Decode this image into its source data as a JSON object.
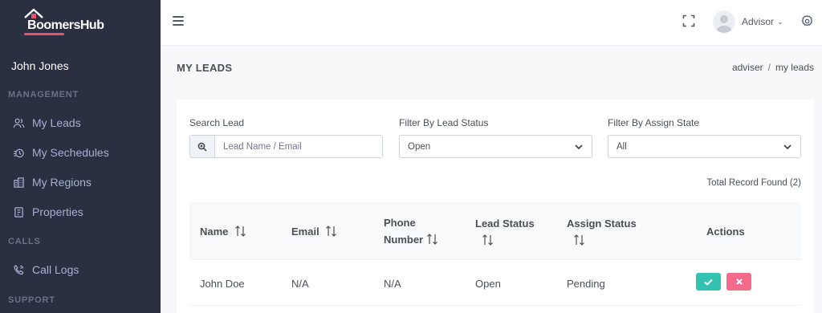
{
  "brand": {
    "logo_text_b": "B",
    "logo_text_rest": "oomers",
    "logo_text_h": "Hub"
  },
  "sidebar": {
    "user_name": "John Jones",
    "sections": [
      {
        "title": "MANAGEMENT"
      },
      {
        "title": "CALLS"
      },
      {
        "title": "SUPPORT"
      }
    ],
    "items": [
      {
        "label": "My Leads",
        "icon": "users-icon"
      },
      {
        "label": "My Sechedules",
        "icon": "schedule-icon"
      },
      {
        "label": "My Regions",
        "icon": "buildings-icon"
      },
      {
        "label": "Properties",
        "icon": "property-icon"
      },
      {
        "label": "Call Logs",
        "icon": "phone-icon"
      }
    ]
  },
  "topbar": {
    "user_label": "Advisor"
  },
  "page": {
    "title": "MY LEADS",
    "breadcrumb": [
      "adviser",
      "/",
      "my leads"
    ]
  },
  "filters": {
    "search_label": "Search Lead",
    "search_placeholder": "Lead Name / Email",
    "status_label": "Filter By Lead Status",
    "status_value": "Open",
    "assign_label": "Filter By Assign State",
    "assign_value": "All"
  },
  "total_records": "Total Record Found (2)",
  "table": {
    "headers": {
      "name": "Name",
      "email": "Email",
      "phone_1": "Phone",
      "phone_2": "Number",
      "lead_status": "Lead Status",
      "assign_status": "Assign Status",
      "actions": "Actions"
    },
    "rows": [
      {
        "name": "John Doe",
        "email": "N/A",
        "phone": "N/A",
        "lead_status": "Open",
        "assign_status": "Pending"
      }
    ]
  },
  "colors": {
    "sidebar_bg": "#2a3042",
    "accept": "#34c3b0",
    "reject": "#f46a8a",
    "brand_accent": "#e9546b"
  }
}
